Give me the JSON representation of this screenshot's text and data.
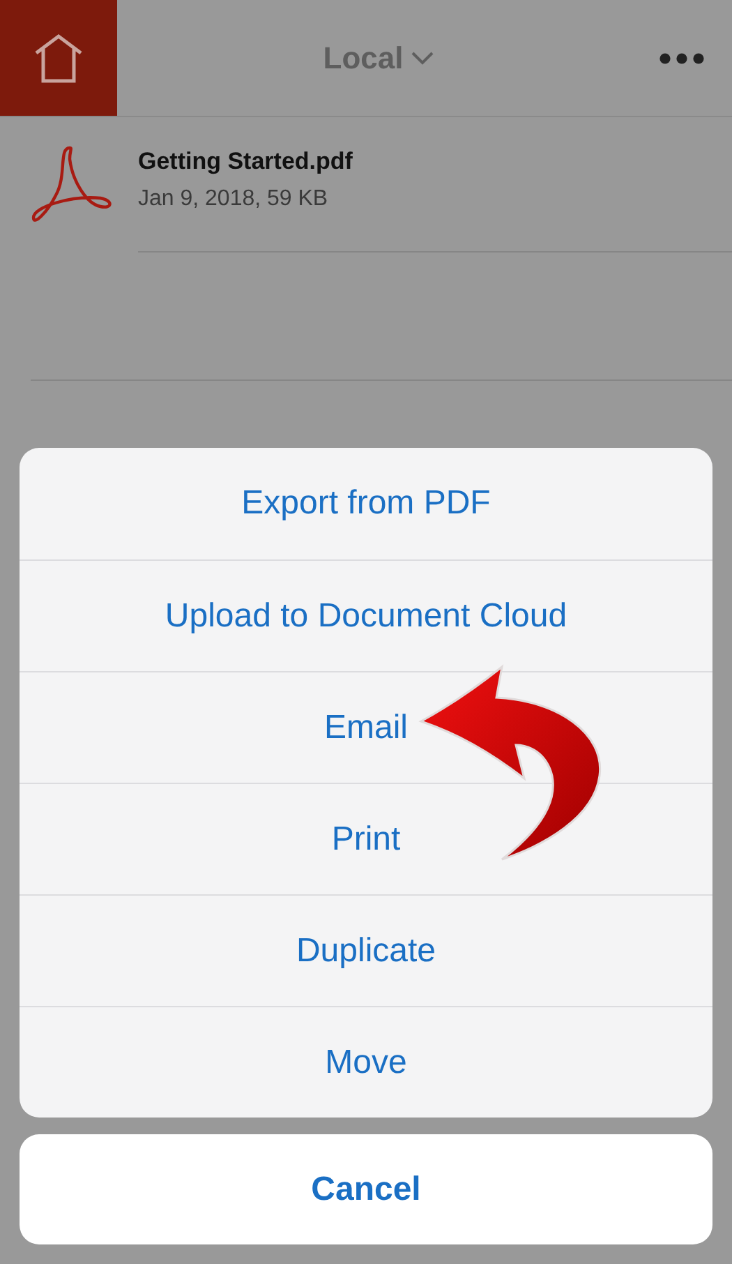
{
  "header": {
    "title": "Local"
  },
  "files": [
    {
      "name": "Getting Started.pdf",
      "meta": "Jan 9, 2018, 59 KB"
    }
  ],
  "action_sheet": {
    "actions": [
      {
        "label": "Export from PDF"
      },
      {
        "label": "Upload to Document Cloud"
      },
      {
        "label": "Email"
      },
      {
        "label": "Print"
      },
      {
        "label": "Duplicate"
      },
      {
        "label": "Move"
      }
    ],
    "cancel": "Cancel"
  }
}
